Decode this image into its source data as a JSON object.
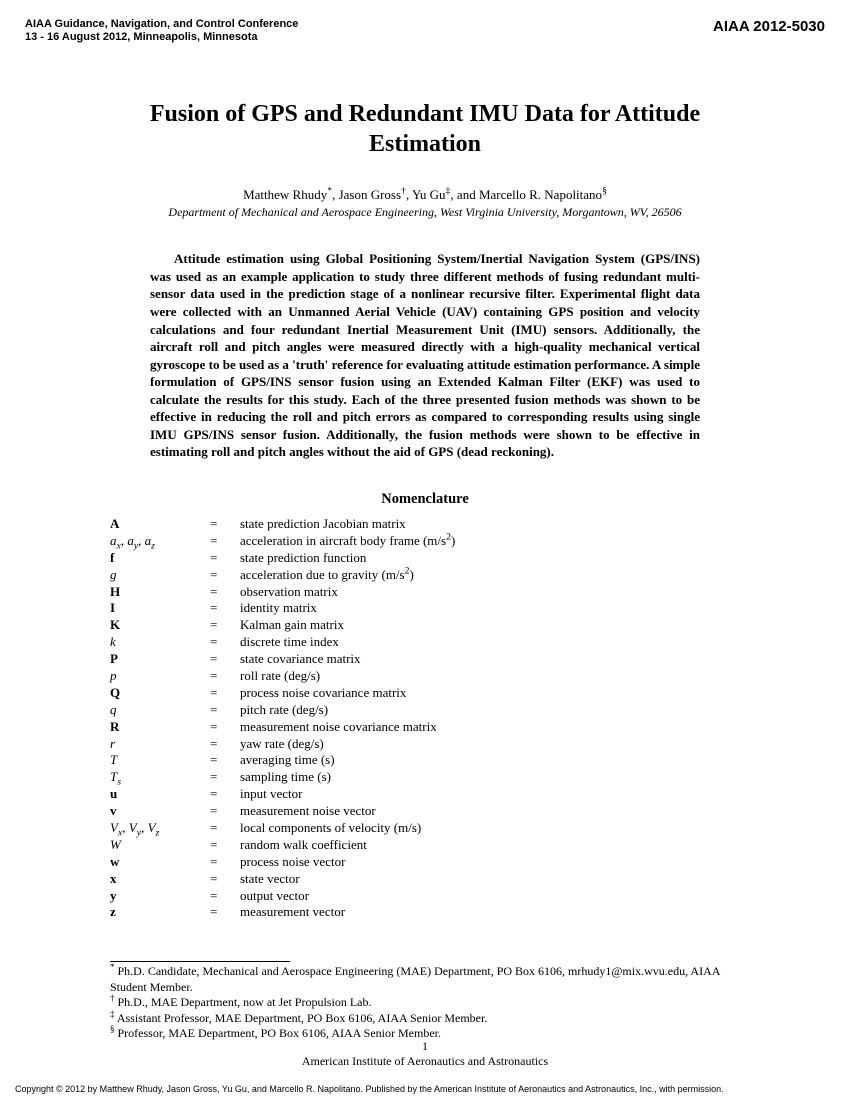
{
  "header": {
    "conf_line1": "AIAA Guidance, Navigation, and Control Conference",
    "conf_line2": "13 - 16 August 2012, Minneapolis, Minnesota",
    "paper_id": "AIAA 2012-5030"
  },
  "title": "Fusion of GPS and Redundant IMU Data for Attitude Estimation",
  "authors_html": "Matthew Rhudy<sup>*</sup>, Jason Gross<sup>†</sup>, Yu Gu<sup>‡</sup>, and Marcello R. Napolitano<sup>§</sup>",
  "affiliation": "Department of Mechanical and Aerospace Engineering, West Virginia University, Morgantown, WV, 26506",
  "abstract": "Attitude estimation using Global Positioning System/Inertial Navigation System (GPS/INS) was used as an example application to study three different methods of fusing redundant multi-sensor data used in the prediction stage of a nonlinear recursive filter. Experimental flight data were collected with an Unmanned Aerial Vehicle (UAV) containing GPS position and velocity calculations and four redundant Inertial Measurement Unit (IMU) sensors. Additionally, the aircraft roll and pitch angles were measured directly with a high-quality mechanical vertical gyroscope to be used as a 'truth' reference for evaluating attitude estimation performance. A simple formulation of GPS/INS sensor fusion using an Extended Kalman Filter (EKF) was used to calculate the results for this study. Each of the three presented fusion methods was shown to be effective in reducing the roll and pitch errors as compared to corresponding results using single IMU GPS/INS sensor fusion. Additionally, the fusion methods were shown to be effective in estimating roll and pitch angles without the aid of GPS (dead reckoning).",
  "nomenclature_heading": "Nomenclature",
  "nomenclature": [
    {
      "s": "<span class='bold'>A</span>",
      "d": "state prediction Jacobian matrix"
    },
    {
      "s": "<span class='ital'>a<sub>x</sub></span>, <span class='ital'>a<sub>y</sub></span>, <span class='ital'>a<sub>z</sub></span>",
      "d": "acceleration in aircraft body frame (m/s<sup>2</sup>)"
    },
    {
      "s": "<span class='bold'>f</span>",
      "d": "state prediction function"
    },
    {
      "s": "<span class='ital'>g</span>",
      "d": "acceleration due to gravity (m/s<sup>2</sup>)"
    },
    {
      "s": "<span class='bold'>H</span>",
      "d": "observation matrix"
    },
    {
      "s": "<span class='bold'>I</span>",
      "d": "identity matrix"
    },
    {
      "s": "<span class='bold'>K</span>",
      "d": "Kalman gain matrix"
    },
    {
      "s": "<span class='ital'>k</span>",
      "d": "discrete time index"
    },
    {
      "s": "<span class='bold'>P</span>",
      "d": "state covariance matrix"
    },
    {
      "s": "<span class='ital'>p</span>",
      "d": "roll rate (deg/s)"
    },
    {
      "s": "<span class='bold'>Q</span>",
      "d": "process noise covariance matrix"
    },
    {
      "s": "<span class='ital'>q</span>",
      "d": "pitch rate (deg/s)"
    },
    {
      "s": "<span class='bold'>R</span>",
      "d": "measurement noise covariance matrix"
    },
    {
      "s": "<span class='ital'>r</span>",
      "d": "yaw rate (deg/s)"
    },
    {
      "s": "<span class='ital'>T</span>",
      "d": "averaging time (s)"
    },
    {
      "s": "<span class='ital'>T<sub>s</sub></span>",
      "d": "sampling time (s)"
    },
    {
      "s": "<span class='bold'>u</span>",
      "d": "input vector"
    },
    {
      "s": "<span class='bold'>v</span>",
      "d": "measurement noise vector"
    },
    {
      "s": "<span class='ital'>V<sub>x</sub></span>, <span class='ital'>V<sub>y</sub></span>, <span class='ital'>V<sub>z</sub></span>",
      "d": "local components of velocity (m/s)"
    },
    {
      "s": "<span class='ital'>W</span>",
      "d": "random walk coefficient"
    },
    {
      "s": "<span class='bold'>w</span>",
      "d": "process noise vector"
    },
    {
      "s": "<span class='bold'>x</span>",
      "d": "state vector"
    },
    {
      "s": "<span class='bold'>y</span>",
      "d": "output vector"
    },
    {
      "s": "<span class='bold'>z</span>",
      "d": "measurement vector"
    }
  ],
  "footnotes": [
    "<sup>*</sup> Ph.D. Candidate, Mechanical and Aerospace Engineering (MAE) Department, PO Box 6106, mrhudy1@mix.wvu.edu, AIAA Student Member.",
    "<sup>†</sup> Ph.D., MAE Department, now at Jet Propulsion Lab.",
    "<sup>‡</sup> Assistant Professor, MAE Department, PO Box 6106, AIAA Senior Member.",
    "<sup>§</sup> Professor, MAE Department, PO Box 6106, AIAA Senior Member."
  ],
  "page_number": "1",
  "page_footer_org": "American Institute of Aeronautics and Astronautics",
  "copyright": "Copyright © 2012 by Matthew Rhudy, Jason Gross, Yu Gu, and Marcello R. Napolitano.  Published by the American Institute of Aeronautics and Astronautics, Inc., with permission."
}
